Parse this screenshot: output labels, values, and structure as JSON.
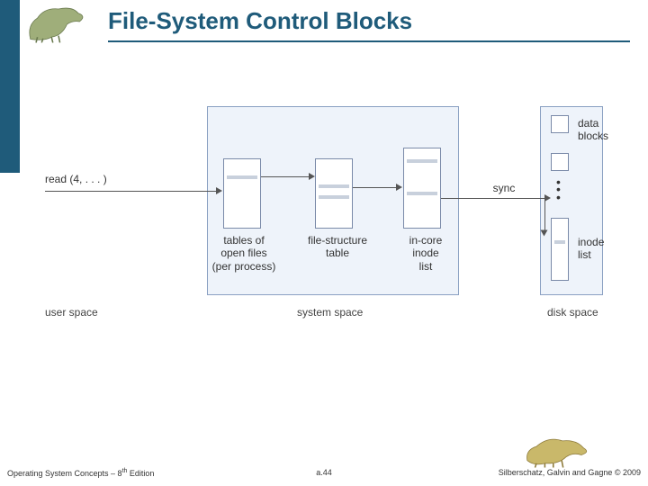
{
  "header": {
    "title": "File-System Control Blocks"
  },
  "diagram": {
    "read_label": "read (4, . . . )",
    "sync_label": "sync",
    "blocks": {
      "tables_of_open_files": "tables of\nopen files\n(per process)",
      "file_structure_table": "file-structure\ntable",
      "in_core_inode_list": "in-core\ninode\nlist",
      "data_blocks": "data\nblocks",
      "inode_list": "inode\nlist"
    },
    "regions": {
      "user_space": "user space",
      "system_space": "system space",
      "disk_space": "disk space"
    }
  },
  "footer": {
    "left_a": "Operating System Concepts – 8",
    "left_sup": "th",
    "left_b": " Edition",
    "center": "a.44",
    "right": "Silberschatz, Galvin and Gagne © 2009"
  },
  "icons": {
    "dino_top": "dinosaur-icon",
    "dino_bottom": "dinosaur-icon"
  }
}
